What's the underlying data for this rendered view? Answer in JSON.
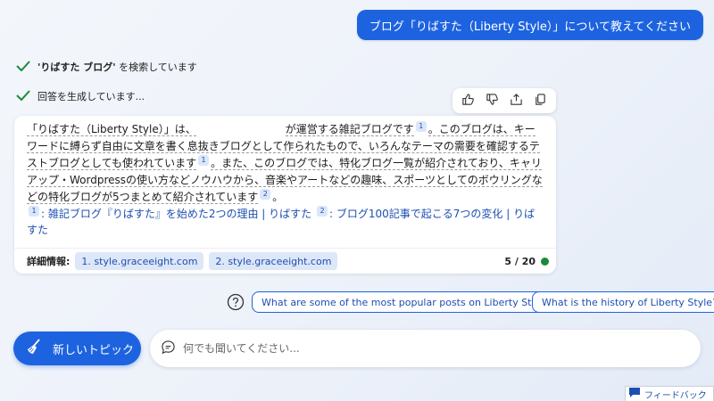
{
  "user_message": "ブログ「りばすた（Liberty Style）」について教えてください",
  "status": {
    "search_query": "'りばすた ブログ'",
    "search_suffix": " を検索しています",
    "generating": "回答を生成しています..."
  },
  "answer": {
    "p1": "「りばすた（Liberty Style）」は、",
    "p2": "が運営する雑記ブログです",
    "p3": "。このブログは、キーワードに縛らず自由に文章を書く息抜きブログとして作られたもので、いろんなテーマの需要を確認するテストブログとしても使われています",
    "p4": "。また、このブログでは、特化ブログ一覧が紹介されており、キャリアップ・Wordpressの使い方などノウハウから、音楽やアートなどの趣味、スポーツとしてのボウリングなどの特化ブログが5つまとめて紹介されています",
    "p5": "。",
    "cite1": "1",
    "cite2": "2"
  },
  "references": [
    {
      "num": "1",
      "text": ": 雑記ブログ『りばすた』を始めた2つの理由 | りばすた"
    },
    {
      "num": "2",
      "text": ": ブログ100記事で起こる7つの変化 | りばすた"
    }
  ],
  "details": {
    "label": "詳細情報:",
    "links": [
      "1. style.graceeight.com",
      "2. style.graceeight.com"
    ],
    "counter": "5 / 20"
  },
  "suggestions": [
    "What are some of the most popular posts on Liberty Style?",
    "What is the history of Liberty Style?"
  ],
  "new_topic_label": "新しいトピック",
  "input_placeholder": "何でも聞いてください...",
  "feedback_label": "フィードバック",
  "colors": {
    "accent": "#1d63e0",
    "link": "#1d4fb0",
    "success": "#1b8a3a"
  },
  "icons": [
    "check-icon",
    "thumbs-up-icon",
    "thumbs-down-icon",
    "share-icon",
    "copy-icon",
    "help-circle-icon",
    "broom-icon",
    "chat-bubble-icon",
    "feedback-icon"
  ]
}
